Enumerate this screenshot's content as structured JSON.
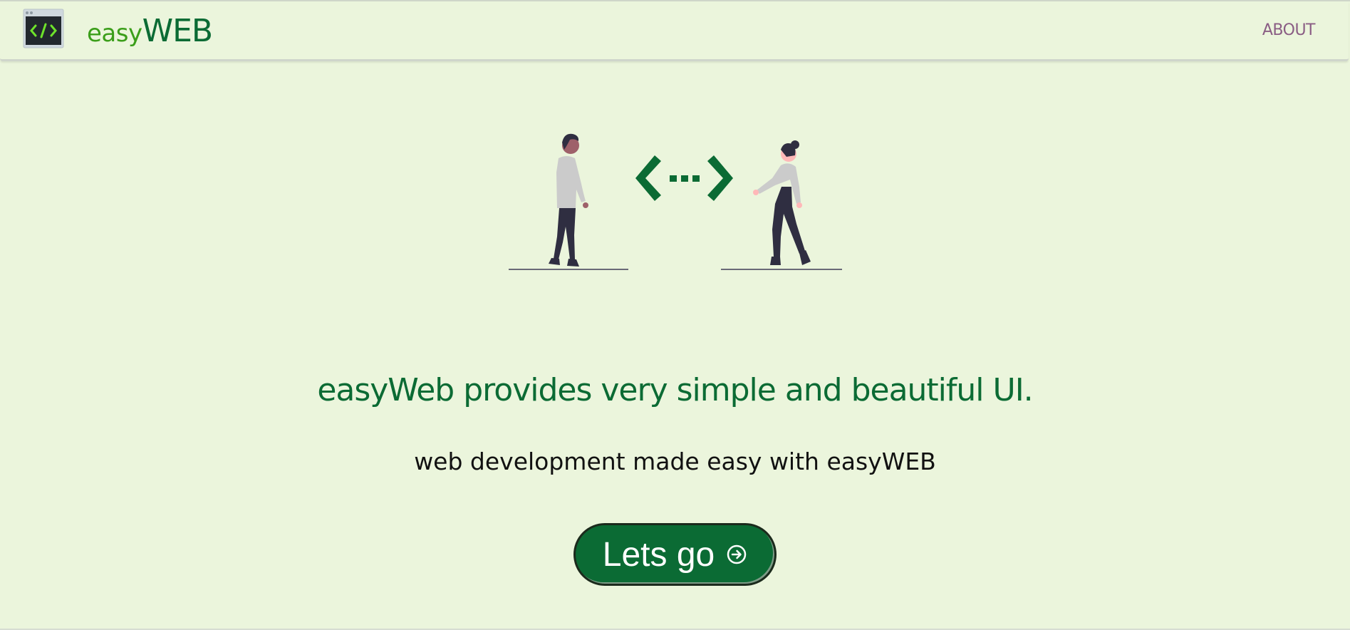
{
  "navbar": {
    "brand_prefix": "easy",
    "brand_suffix": "WEB",
    "about_label": "ABOUT"
  },
  "hero": {
    "title": "easyWeb provides very simple and beautiful UI.",
    "subtitle": "web development made easy with easyWEB",
    "cta_label": "Lets go"
  },
  "colors": {
    "background": "#ebf5dc",
    "brand_green": "#0b6b34",
    "brand_light_green": "#3b9e1a",
    "about_link": "#8a5d84"
  },
  "icons": {
    "logo": "code-window-icon",
    "cta": "arrow-right-circle-icon"
  }
}
